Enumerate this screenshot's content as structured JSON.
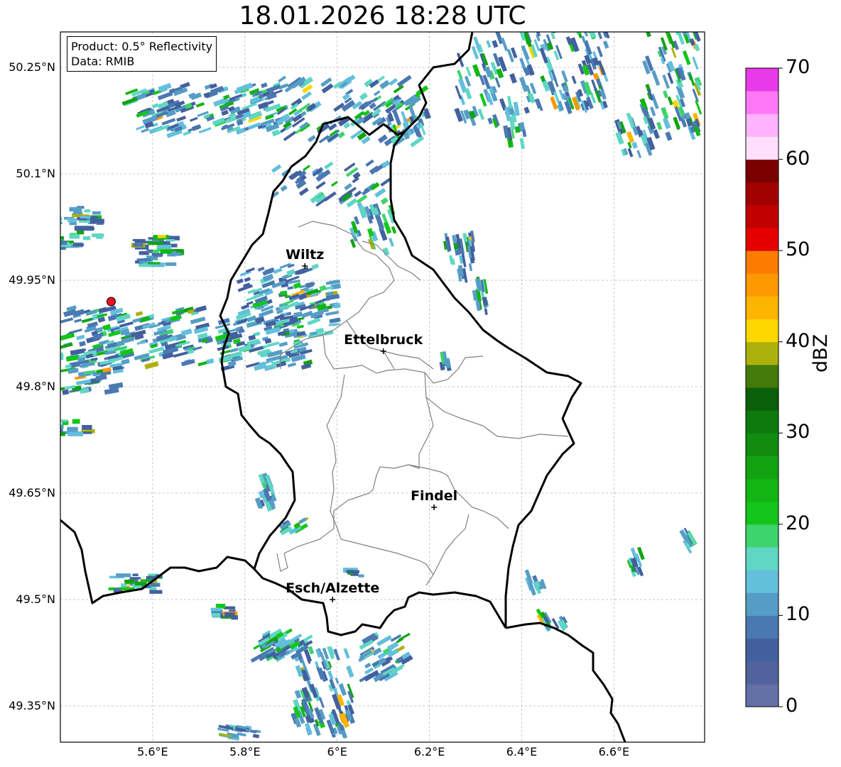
{
  "title": "18.01.2026 18:28 UTC",
  "info_box": {
    "product": "Product: 0.5° Reflectivity",
    "data_source": "Data: RMIB"
  },
  "lat_ticks": [
    "50.25°N",
    "50.1°N",
    "49.95°N",
    "49.8°N",
    "49.65°N",
    "49.5°N",
    "49.35°N"
  ],
  "lon_ticks": [
    "5.6°E",
    "5.8°E",
    "6°E",
    "6.2°E",
    "6.4°E",
    "6.6°E"
  ],
  "cities": [
    {
      "name": "Wiltz",
      "lon": 5.93,
      "lat": 49.97
    },
    {
      "name": "Ettelbruck",
      "lon": 6.1,
      "lat": 49.85
    },
    {
      "name": "Findel",
      "lon": 6.21,
      "lat": 49.63
    },
    {
      "name": "Esch/Alzette",
      "lon": 5.99,
      "lat": 49.5
    }
  ],
  "radar_site": {
    "lon": 5.51,
    "lat": 49.92,
    "color": "#e8141e"
  },
  "colorbar": {
    "label": "dBZ",
    "tick_labels": [
      "0",
      "10",
      "20",
      "30",
      "40",
      "50",
      "60",
      "70"
    ],
    "colors": [
      "#6370a8",
      "#52629c",
      "#43609e",
      "#4a78b0",
      "#569dc6",
      "#63bfdc",
      "#60d6c4",
      "#3ed36c",
      "#14c619",
      "#12b514",
      "#12a212",
      "#118c0f",
      "#0c7a0c",
      "#0a5f0a",
      "#437a0a",
      "#adb00a",
      "#fdd600",
      "#fdb500",
      "#fd9800",
      "#fd7c00",
      "#e50000",
      "#c10000",
      "#a10000",
      "#7a0000",
      "#ffdffd",
      "#ffb4fd",
      "#ff79f6",
      "#e93ae9"
    ]
  }
}
